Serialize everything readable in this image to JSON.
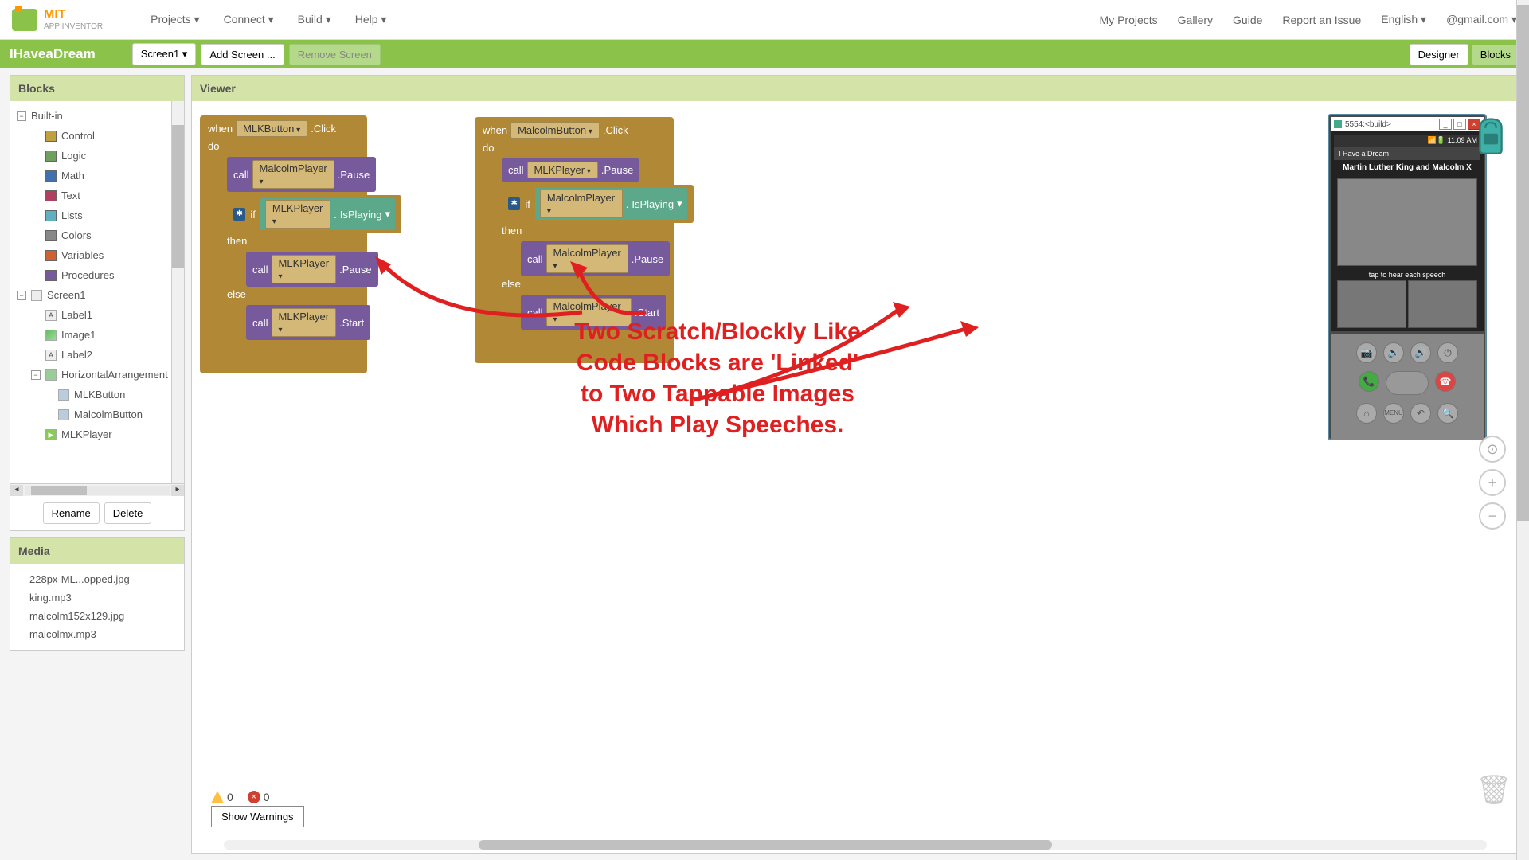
{
  "brand": {
    "mit": "MIT",
    "sub": "APP INVENTOR"
  },
  "topmenu": {
    "projects": "Projects ▾",
    "connect": "Connect ▾",
    "build": "Build ▾",
    "help": "Help ▾"
  },
  "topright": {
    "myprojects": "My Projects",
    "gallery": "Gallery",
    "guide": "Guide",
    "report": "Report an Issue",
    "english": "English ▾",
    "email": "@gmail.com ▾"
  },
  "greenbar": {
    "title": "IHaveaDream",
    "screenSel": "Screen1 ▾",
    "addScreen": "Add Screen ...",
    "removeScreen": "Remove Screen",
    "designer": "Designer",
    "blocks": "Blocks"
  },
  "panels": {
    "blocks": "Blocks",
    "viewer": "Viewer",
    "media": "Media"
  },
  "categories": {
    "builtin": "Built-in",
    "control": {
      "label": "Control",
      "color": "#c0a040"
    },
    "logic": {
      "label": "Logic",
      "color": "#70a060"
    },
    "math": {
      "label": "Math",
      "color": "#4070b0"
    },
    "text": {
      "label": "Text",
      "color": "#b04060"
    },
    "lists": {
      "label": "Lists",
      "color": "#60b0c0"
    },
    "colors": {
      "label": "Colors",
      "color": "#888888"
    },
    "variables": {
      "label": "Variables",
      "color": "#d06030"
    },
    "procedures": {
      "label": "Procedures",
      "color": "#765a9c"
    }
  },
  "components": {
    "screen1": "Screen1",
    "label1": "Label1",
    "image1": "Image1",
    "label2": "Label2",
    "harr": "HorizontalArrangement",
    "mlkbtn": "MLKButton",
    "malcbtn": "MalcolmButton",
    "mlkplayer": "MLKPlayer"
  },
  "treeButtons": {
    "rename": "Rename",
    "delete": "Delete"
  },
  "media": {
    "f1": "228px-ML...opped.jpg",
    "f2": "king.mp3",
    "f3": "malcolm152x129.jpg",
    "f4": "malcolmx.mp3"
  },
  "blocks": {
    "when": "when",
    "do": "do",
    "call": "call",
    "if": "if",
    "then": "then",
    "else": "else",
    "click": ".Click",
    "pause": ".Pause",
    "start": ".Start",
    "isplaying": "IsPlaying",
    "mlkbutton": "MLKButton",
    "malcolmbutton": "MalcolmButton",
    "mlkplayer": "MLKPlayer",
    "malcolmplayer": "MalcolmPlayer"
  },
  "emulator": {
    "title": "5554:<build>",
    "time": "11:09 AM",
    "appTitle": "I Have a Dream",
    "header": "Martin Luther King and Malcolm X",
    "tap": "tap to hear each speech"
  },
  "warnings": {
    "warn": "0",
    "err": "0",
    "show": "Show Warnings"
  },
  "annotation": {
    "l1": "Two Scratch/Blockly Like",
    "l2": "Code Blocks are 'Linked'",
    "l3": "to Two Tappable Images",
    "l4": "Which Play Speeches."
  }
}
